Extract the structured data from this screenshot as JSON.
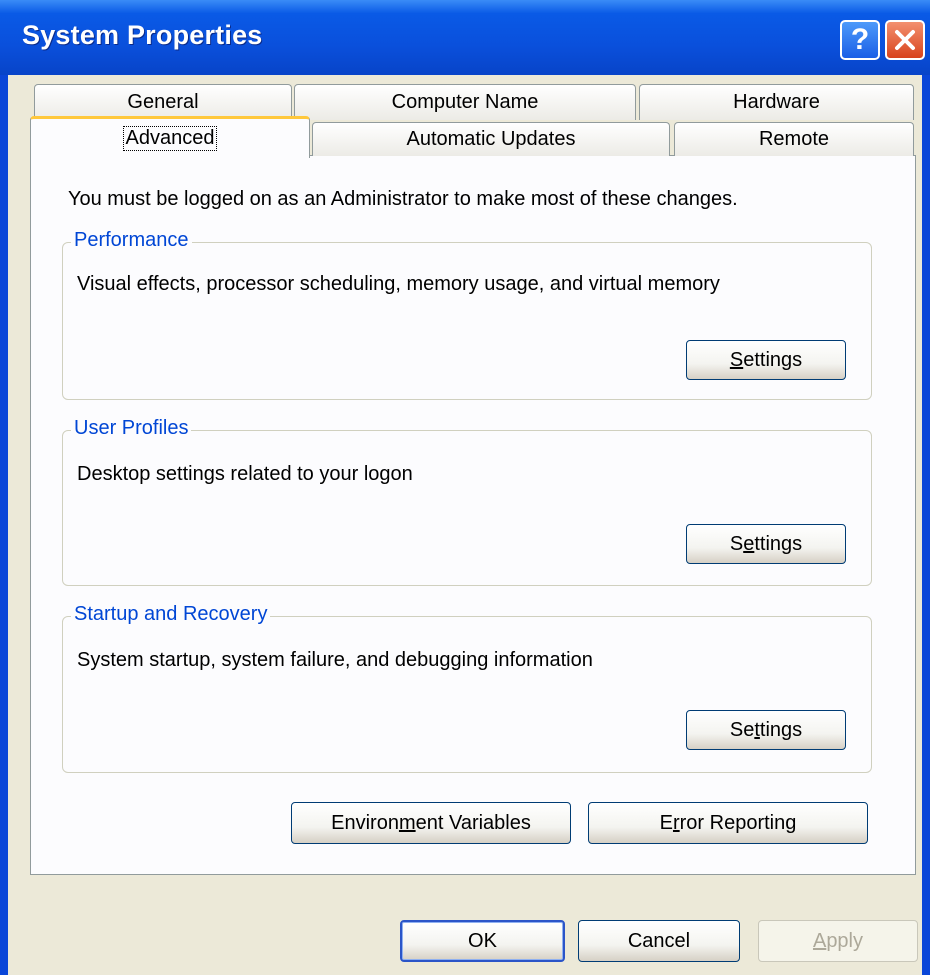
{
  "window": {
    "title": "System Properties"
  },
  "title_buttons": {
    "help_glyph": "?",
    "close_icon": "close-icon"
  },
  "tabs": {
    "row_back": [
      "General",
      "Computer Name",
      "Hardware"
    ],
    "row_front": [
      "Advanced",
      "Automatic Updates",
      "Remote"
    ],
    "active": "Advanced"
  },
  "info_text": "You must be logged on as an Administrator to make most of these changes.",
  "groups": [
    {
      "label": "Performance",
      "description": "Visual effects, processor scheduling, memory usage, and virtual memory",
      "button": {
        "pre": "",
        "key": "S",
        "post": "ettings"
      }
    },
    {
      "label": "User Profiles",
      "description": "Desktop settings related to your logon",
      "button": {
        "pre": "S",
        "key": "e",
        "post": "ttings"
      }
    },
    {
      "label": "Startup and Recovery",
      "description": "System startup, system failure, and debugging information",
      "button": {
        "pre": "Se",
        "key": "t",
        "post": "tings"
      }
    }
  ],
  "env_button": {
    "pre": "Environ",
    "key": "m",
    "post": "ent Variables"
  },
  "error_button": {
    "pre": "E",
    "key": "r",
    "post": "ror Reporting"
  },
  "footer": {
    "ok": "OK",
    "cancel": "Cancel",
    "apply": {
      "pre": "",
      "key": "A",
      "post": "pply"
    }
  },
  "colors": {
    "title_bar": "#0a50dc",
    "group_label": "#0046d5",
    "dialog_bg": "#ece9d8",
    "active_tab_accent": "#ffc83c",
    "close_button": "#d8431c"
  }
}
